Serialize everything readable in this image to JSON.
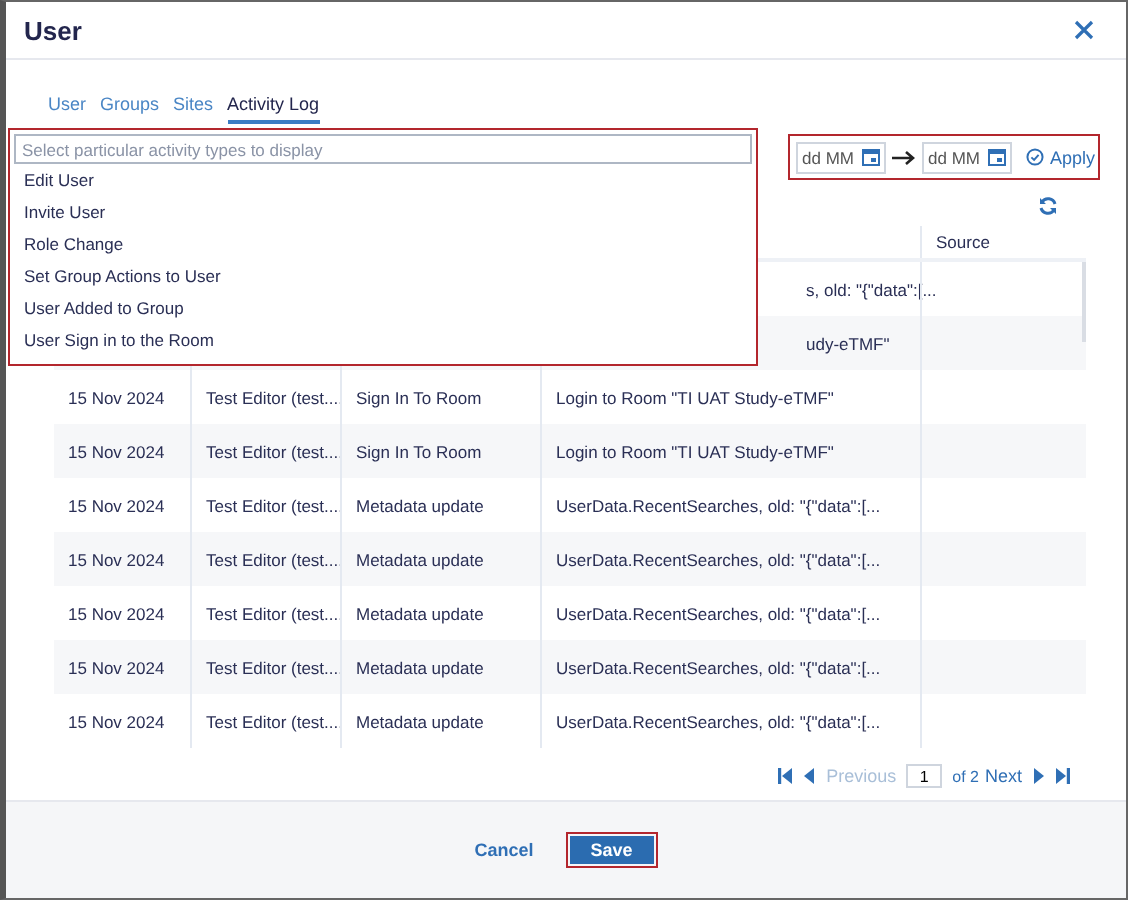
{
  "dialog": {
    "title": "User"
  },
  "tabs": [
    {
      "label": "User",
      "selected": false
    },
    {
      "label": "Groups",
      "selected": false
    },
    {
      "label": "Sites",
      "selected": false
    },
    {
      "label": "Activity Log",
      "selected": true
    }
  ],
  "filter": {
    "placeholder": "Select particular activity types to display",
    "options": [
      "Edit User",
      "Invite User",
      "Role Change",
      "Set Group Actions to User",
      "User Added to Group",
      "User Sign in to the Room"
    ]
  },
  "date_range": {
    "from_placeholder": "dd MM",
    "to_placeholder": "dd MM",
    "apply": "Apply"
  },
  "table": {
    "header": {
      "column_5": "Source"
    },
    "rows": [
      {
        "details": "s, old: \"{\"data\":[..."
      },
      {
        "details": "udy-eTMF\""
      },
      {
        "date": "15 Nov 2024",
        "user": "Test Editor (test....",
        "action": "Sign In To Room",
        "details": "Login to Room \"TI UAT Study-eTMF\""
      },
      {
        "date": "15 Nov 2024",
        "user": "Test Editor (test....",
        "action": "Sign In To Room",
        "details": "Login to Room \"TI UAT Study-eTMF\""
      },
      {
        "date": "15 Nov 2024",
        "user": "Test Editor (test....",
        "action": "Metadata update",
        "details": "UserData.RecentSearches, old: \"{\"data\":[..."
      },
      {
        "date": "15 Nov 2024",
        "user": "Test Editor (test....",
        "action": "Metadata update",
        "details": "UserData.RecentSearches, old: \"{\"data\":[..."
      },
      {
        "date": "15 Nov 2024",
        "user": "Test Editor (test....",
        "action": "Metadata update",
        "details": "UserData.RecentSearches, old: \"{\"data\":[..."
      },
      {
        "date": "15 Nov 2024",
        "user": "Test Editor (test....",
        "action": "Metadata update",
        "details": "UserData.RecentSearches, old: \"{\"data\":[..."
      },
      {
        "date": "15 Nov 2024",
        "user": "Test Editor (test....",
        "action": "Metadata update",
        "details": "UserData.RecentSearches, old: \"{\"data\":[..."
      }
    ]
  },
  "pagination": {
    "previous": "Previous",
    "previous_disabled": true,
    "page": "1",
    "of": "of 2",
    "next": "Next"
  },
  "footer": {
    "cancel": "Cancel",
    "save": "Save"
  }
}
